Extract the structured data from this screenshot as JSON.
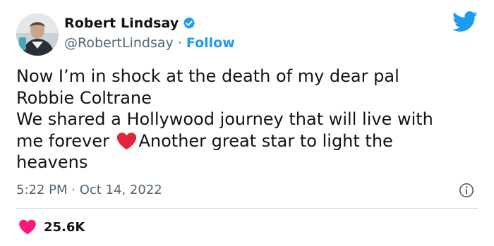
{
  "author": {
    "name": "Robert Lindsay",
    "handle": "@RobertLindsay",
    "separator": "·",
    "follow_label": "Follow",
    "verified": true
  },
  "tweet": {
    "lines": [
      "Now I’m in shock at the death of my dear pal",
      "Robbie Coltrane",
      "We shared a Hollywood journey that will live with",
      "me forever ",
      "Another great star to light the",
      "heavens"
    ],
    "emoji": "red-heart-emoji"
  },
  "meta": {
    "time": "5:22 PM",
    "separator": "·",
    "date": "Oct 14, 2022"
  },
  "engagement": {
    "likes": "25.6K"
  },
  "colors": {
    "accent": "#1d9bf0",
    "heart": "#f91880",
    "emoji_heart": "#e0243a",
    "muted": "#536471",
    "divider": "#cfd9de"
  },
  "icons": [
    "twitter-bird-icon",
    "verified-badge-icon",
    "info-icon",
    "like-heart-icon"
  ]
}
